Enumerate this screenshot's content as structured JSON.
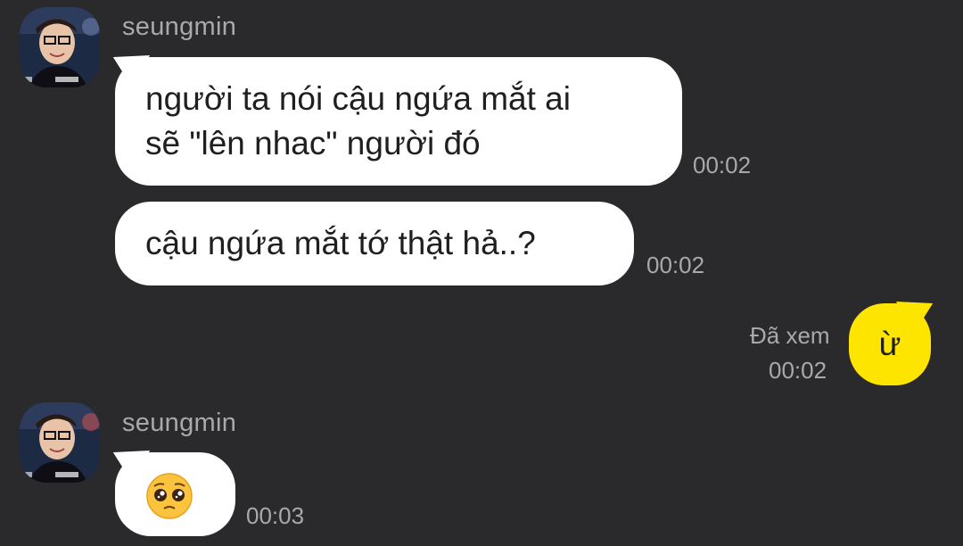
{
  "messages": [
    {
      "sender": "seungmin",
      "avatar_icon": "profile-photo-icon",
      "bubbles": [
        {
          "lines": [
            "người ta nói cậu ngứa mắt ai",
            "sẽ \"lên nhac\" người đó"
          ],
          "time": "00:02"
        },
        {
          "lines": [
            "cậu ngứa mắt tớ thật hả..?"
          ],
          "time": "00:02"
        }
      ]
    },
    {
      "sender": "me",
      "bubbles": [
        {
          "text": "ừ",
          "time": "00:02",
          "read_label": "Đã xem"
        }
      ]
    },
    {
      "sender": "seungmin",
      "avatar_icon": "profile-photo-icon",
      "bubbles": [
        {
          "emoji": "pleading-face-emoji-icon",
          "time": "00:03"
        }
      ]
    }
  ],
  "colors": {
    "background": "#2a2a2c",
    "incoming_bubble": "#ffffff",
    "outgoing_bubble": "#fee500",
    "meta_text": "#a9a9ad"
  }
}
